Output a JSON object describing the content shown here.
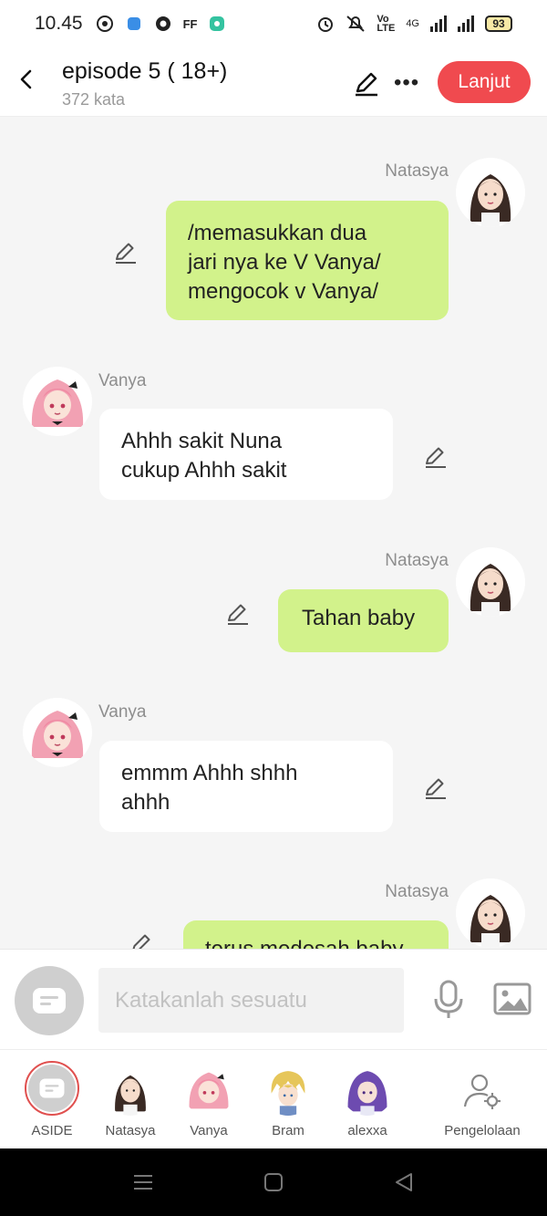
{
  "status_bar": {
    "time": "10.45",
    "battery": "93",
    "network": "4G"
  },
  "header": {
    "title": "episode 5 ( 18+)",
    "subtitle": "372 kata",
    "next_button": "Lanjut"
  },
  "messages": [
    {
      "sender": "Natasya",
      "side": "right",
      "text_lines": [
        "/memasukkan dua",
        "jari nya ke V Vanya/",
        "mengocok v Vanya/"
      ]
    },
    {
      "sender": "Vanya",
      "side": "left",
      "text_lines": [
        "Ahhh sakit Nuna",
        "cukup Ahhh sakit"
      ]
    },
    {
      "sender": "Natasya",
      "side": "right",
      "text_lines": [
        "Tahan baby"
      ]
    },
    {
      "sender": "Vanya",
      "side": "left",
      "text_lines": [
        "emmm Ahhh shhh",
        "ahhh"
      ]
    },
    {
      "sender": "Natasya",
      "side": "right",
      "text_lines": [
        "terus medesah baby"
      ]
    }
  ],
  "input": {
    "placeholder": "Katakanlah sesuatu"
  },
  "characters": [
    {
      "label": "ASIDE"
    },
    {
      "label": "Natasya"
    },
    {
      "label": "Vanya"
    },
    {
      "label": "Bram"
    },
    {
      "label": "alexxa"
    },
    {
      "label": "Pengelolaan"
    }
  ],
  "colors": {
    "accent": "#f04a4f",
    "bubble_green": "#d2f28b",
    "bubble_white": "#ffffff",
    "background": "#f5f5f5"
  }
}
